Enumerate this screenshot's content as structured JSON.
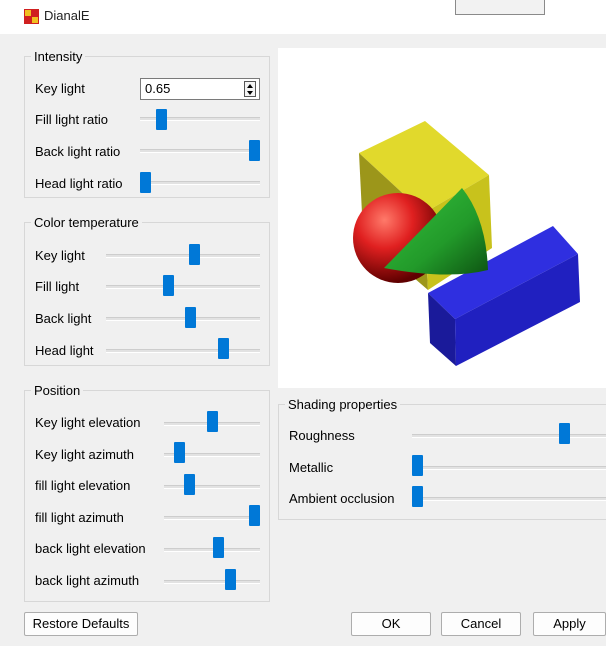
{
  "window": {
    "title": "DianalE"
  },
  "intensity": {
    "title": "Intensity",
    "key_light": {
      "label": "Key light",
      "value": "0.65"
    },
    "fill_light_ratio": {
      "label": "Fill light ratio",
      "level": 0.15
    },
    "back_light_ratio": {
      "label": "Back light ratio",
      "level": 1.0
    },
    "head_light_ratio": {
      "label": "Head light ratio",
      "level": 0.0
    }
  },
  "color_temperature": {
    "title": "Color temperature",
    "key_light": {
      "label": "Key light",
      "level": 0.58
    },
    "fill_light": {
      "label": "Fill light",
      "level": 0.4
    },
    "back_light": {
      "label": "Back light",
      "level": 0.55
    },
    "head_light": {
      "label": "Head light",
      "level": 0.78
    }
  },
  "position": {
    "title": "Position",
    "key_light_elevation": {
      "label": "Key light elevation",
      "level": 0.5
    },
    "key_light_azimuth": {
      "label": "Key light azimuth",
      "level": 0.12
    },
    "fill_light_elevation": {
      "label": "fill light elevation",
      "level": 0.23
    },
    "fill_light_azimuth": {
      "label": "fill light azimuth",
      "level": 1.0
    },
    "back_light_elevation": {
      "label": "back light elevation",
      "level": 0.58
    },
    "back_light_azimuth": {
      "label": "back light azimuth",
      "level": 0.72
    }
  },
  "shading": {
    "title": "Shading properties",
    "roughness": {
      "label": "Roughness",
      "level": 0.78
    },
    "metallic": {
      "label": "Metallic",
      "level": 0.0
    },
    "ambient_occlusion": {
      "label": "Ambient occlusion",
      "level": 0.0
    }
  },
  "buttons": {
    "restore_defaults": "Restore Defaults",
    "ok": "OK",
    "cancel": "Cancel",
    "apply": "Apply"
  },
  "colors": {
    "slider_handle": "#0078d7",
    "window_background": "#f0f0f0",
    "preview_background": "#ffffff",
    "cube_yellow": "#c8c21c",
    "sphere_red": "#e02020",
    "cone_green": "#22a02a",
    "box_blue": "#2020c8"
  }
}
